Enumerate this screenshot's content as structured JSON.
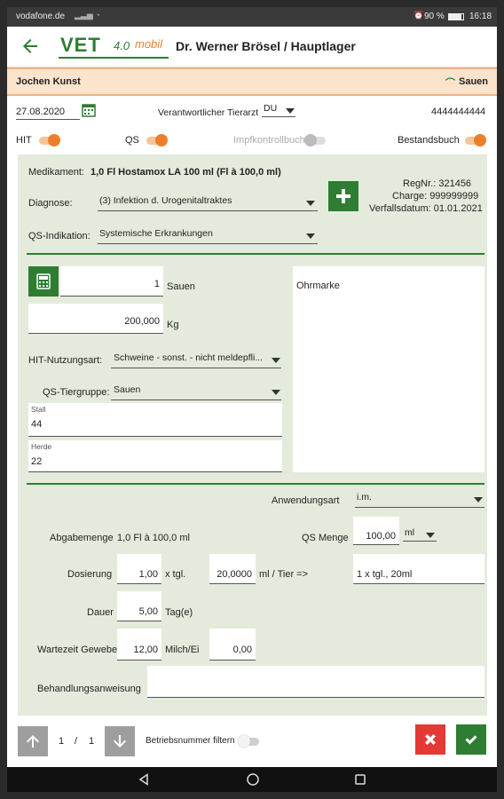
{
  "statusbar": {
    "carrier": "vodafone.de",
    "battery": "90 %",
    "time": "16:18"
  },
  "appbar": {
    "logo_text": "VET",
    "logo_suffix": "4.0",
    "logo_mobil": "mobil",
    "title": "Dr. Werner  Brösel / Hauptlager"
  },
  "userbar": {
    "user": "Jochen Kunst",
    "category": "Sauen"
  },
  "top": {
    "date": "27.08.2020",
    "vet_label": "Verantwortlicher Tierarzt",
    "vet_value": "DU",
    "number": "4444444444",
    "toggles": [
      {
        "label": "HIT",
        "state": "on"
      },
      {
        "label": "QS",
        "state": "on"
      },
      {
        "label": "Impfkontrollbuch",
        "state": "disabled"
      },
      {
        "label": "Bestandsbuch",
        "state": "on"
      }
    ]
  },
  "form": {
    "medikament_label": "Medikament:",
    "medikament_value": "1,0 Fl Hostamox LA 100 ml (Fl à 100,0 ml)",
    "regnr": "RegNr.:       321456",
    "charge": "Charge: 999999999",
    "verfall": "Verfallsdatum: 01.01.2021",
    "diagnose_label": "Diagnose:",
    "diagnose_value": "(3) Infektion d. Urogenitaltraktes",
    "qs_indikation_label": "QS-Indikation:",
    "qs_indikation_value": "Systemische Erkrankungen",
    "count_value": "1",
    "count_unit": "Sauen",
    "weight_value": "200,000",
    "weight_unit": "Kg",
    "ohrmarke_label": "Ohrmarke",
    "hit_nutzungsart_label": "HIT-Nutzungsart:",
    "hit_nutzungsart_value": "Schweine - sonst. - nicht meldepfli...",
    "qs_tiergruppe_label": "QS-Tiergruppe:",
    "qs_tiergruppe_value": "Sauen",
    "stall_label": "Stall",
    "stall_value": "44",
    "herde_label": "Herde",
    "herde_value": "22",
    "anwendungsart_label": "Anwendungsart",
    "anwendungsart_value": "i.m.",
    "abgabemenge_label": "Abgabemenge",
    "abgabemenge_value": "1,0 Fl à 100,0 ml",
    "qs_menge_label": "QS Menge",
    "qs_menge_value": "100,00",
    "qs_menge_unit": "ml",
    "dosierung_label": "Dosierung",
    "dosierung_value": "1,00",
    "dosierung_unit": "x tgl.",
    "dosis_value": "20,0000",
    "dosis_unit": "ml / Tier =>",
    "dosis_result": "1 x tgl., 20ml",
    "dauer_label": "Dauer",
    "dauer_value": "5,00",
    "dauer_unit": "Tag(e)",
    "wartezeit_label": "Wartezeit Gewebe",
    "wartezeit_value": "12,00",
    "milch_label": "Milch/Ei",
    "milch_value": "0,00",
    "behandlung_label": "Behandlungsanweisung",
    "behandlung_value": ""
  },
  "bottombar": {
    "page_current": "1",
    "page_sep": "/",
    "page_total": "1",
    "filter_label": "Betriebsnummer filtern"
  },
  "colors": {
    "green": "#2e7d32",
    "orange": "#ee7f2a",
    "red": "#e53935",
    "form_bg": "#e4ebdc"
  }
}
